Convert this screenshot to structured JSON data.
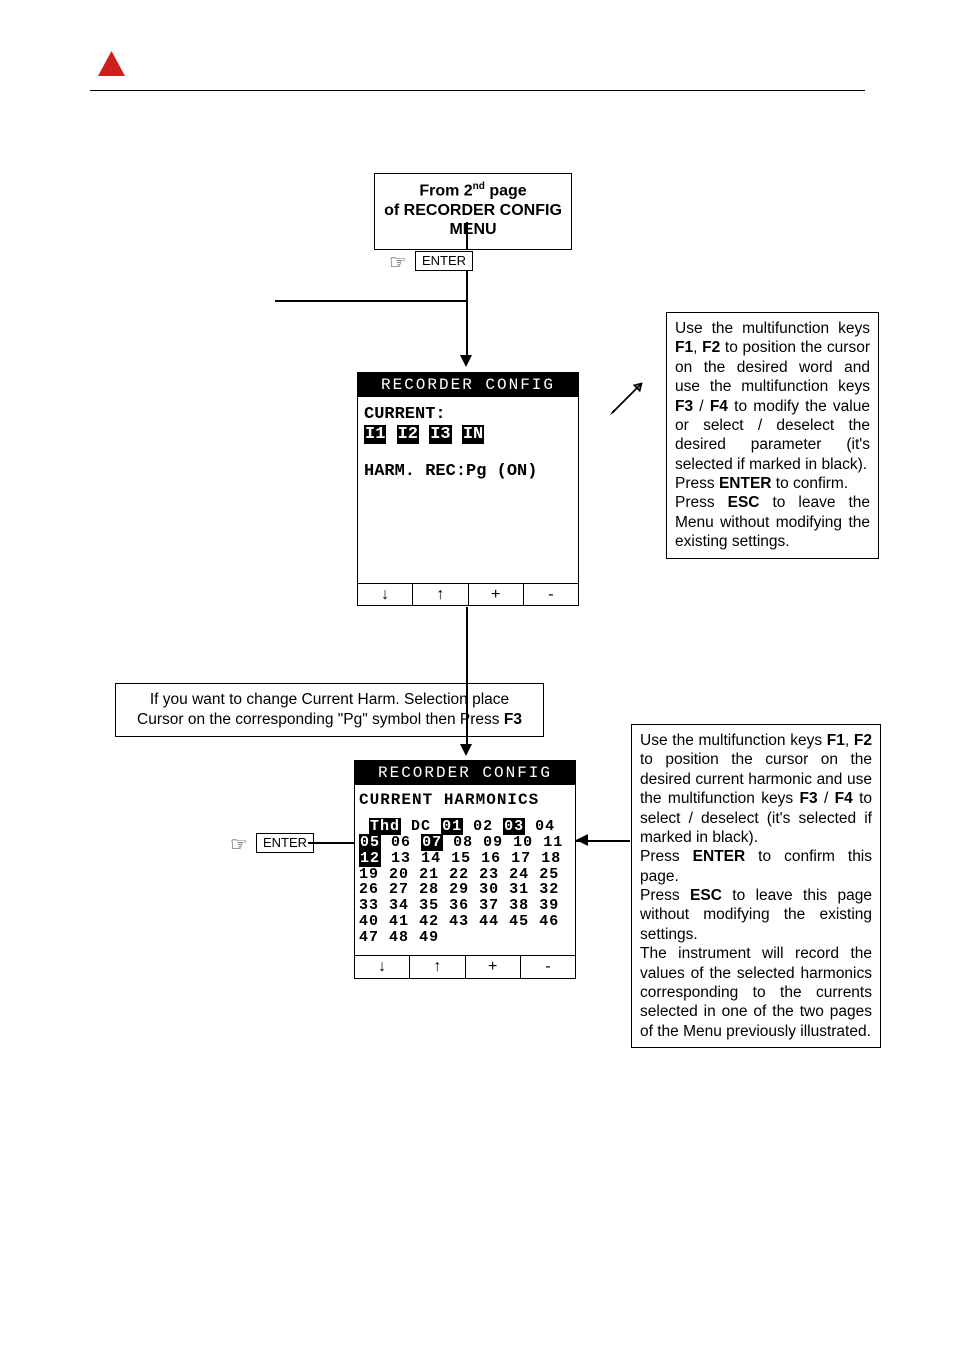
{
  "topbox": {
    "line1_prefix": "From 2",
    "line1_suffix": " page",
    "sup": "nd",
    "line2": "of RECORDER CONFIG MENU"
  },
  "enter_label": "ENTER",
  "screen1": {
    "title": "RECORDER CONFIG",
    "current_label": "CURRENT:",
    "i1": "I1",
    "i2": "I2",
    "i3": "I3",
    "in": "IN",
    "harm_line": "HARM. REC:Pg (ON)",
    "fkeys": {
      "a": "↓",
      "b": "↑",
      "c": "+",
      "d": "-"
    }
  },
  "screen2": {
    "title": "RECORDER CONFIG",
    "subtitle": "CURRENT HARMONICS",
    "thd": "Thd",
    "dc": "DC",
    "h01": "01",
    "h02": "02",
    "h03": "03",
    "h04": "04",
    "h05": "05",
    "h06": "06",
    "h07": "07",
    "h08": "08",
    "h09": "09",
    "h10": "10",
    "h11": "11",
    "h12": "12",
    "h13": "13",
    "h14": "14",
    "h15": "15",
    "h16": "16",
    "h17": "17",
    "h18": "18",
    "h19": "19",
    "h20": "20",
    "h21": "21",
    "h22": "22",
    "h23": "23",
    "h24": "24",
    "h25": "25",
    "h26": "26",
    "h27": "27",
    "h28": "28",
    "h29": "29",
    "h30": "30",
    "h31": "31",
    "h32": "32",
    "h33": "33",
    "h34": "34",
    "h35": "35",
    "h36": "36",
    "h37": "37",
    "h38": "38",
    "h39": "39",
    "h40": "40",
    "h41": "41",
    "h42": "42",
    "h43": "43",
    "h44": "44",
    "h45": "45",
    "h46": "46",
    "h47": "47",
    "h48": "48",
    "h49": "49",
    "fkeys": {
      "a": "↓",
      "b": "↑",
      "c": "+",
      "d": "-"
    }
  },
  "info1": {
    "p1a": "Use the multifunction keys ",
    "f1": "F1",
    "sep1": ", ",
    "f2": "F2",
    "p1b": " to position the cursor on the desired word and use the multifunction keys ",
    "f3": "F3",
    "slash": " / ",
    "f4": "F4",
    "p1c": " to modify the value or select / deselect the desired parameter (it's selected if marked in black).",
    "p2a": "Press ",
    "enter": "ENTER",
    "p2b": " to confirm.",
    "p3a": "Press ",
    "esc": "ESC",
    "p3b": " to leave the Menu without modifying the existing settings."
  },
  "note": {
    "line1": "If you want to change Current Harm. Selection place",
    "line2a": "Cursor on the corresponding \"Pg\" symbol then Press ",
    "f3": "F3"
  },
  "info2": {
    "p1a": "Use the multifunction keys ",
    "f1": "F1",
    "sep1": ", ",
    "f2": "F2",
    "p1b": " to position the cursor on the desired current harmonic and use the multifunction keys ",
    "f3": "F3",
    "slash": " / ",
    "f4": "F4",
    "p1c": " to select / deselect (it's selected if marked in black).",
    "p2a": "Press ",
    "enter": "ENTER",
    "p2b": " to confirm this page.",
    "p3a": "Press ",
    "esc": "ESC",
    "p3b": " to leave this page without modifying the existing settings.",
    "p4": "The instrument will record the values of the selected harmonics corresponding to the currents selected in one of the two pages of the Menu previously illustrated."
  }
}
